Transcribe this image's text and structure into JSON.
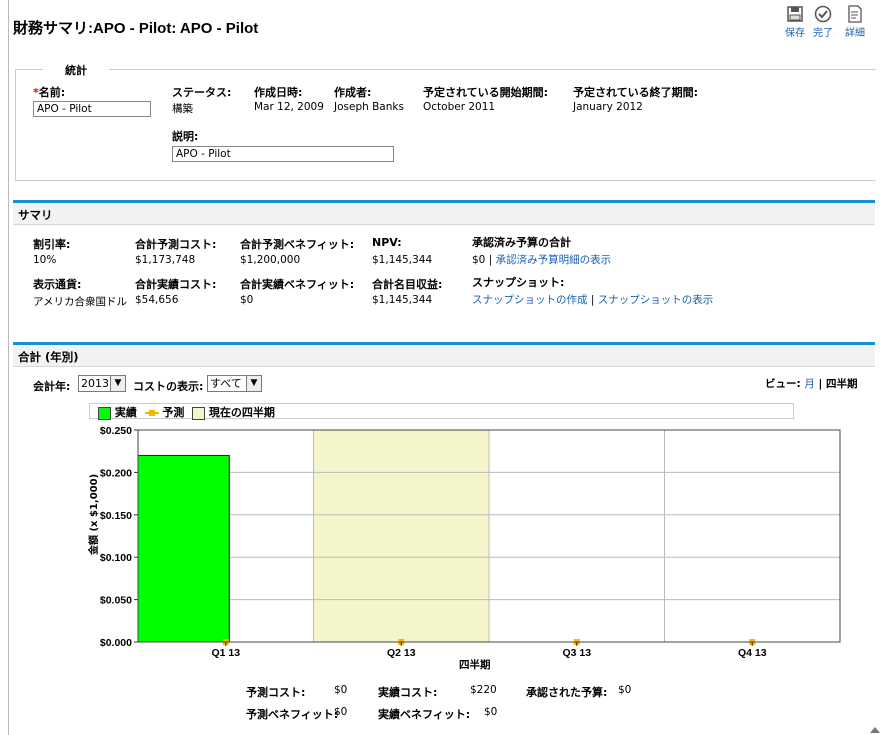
{
  "page": {
    "title": "財務サマリ:APO - Pilot: APO - Pilot"
  },
  "toolbar": {
    "save": "保存",
    "done": "完了",
    "details": "詳細"
  },
  "stats": {
    "legend": "統計",
    "name_label": "名前:",
    "name_value": "APO - Pilot",
    "status_label": "ステータス:",
    "status_value": "構築",
    "created_date_label": "作成日時:",
    "created_date_value": "Mar 12, 2009",
    "created_by_label": "作成者:",
    "created_by_value": "Joseph Banks",
    "planned_start_label": "予定されている開始期間:",
    "planned_start_value": "October 2011",
    "planned_end_label": "予定されている終了期間:",
    "planned_end_value": "January 2012",
    "description_label": "説明:",
    "description_value": "APO - Pilot"
  },
  "summary": {
    "heading": "サマリ",
    "discount_label": "割引率:",
    "discount_value": "10%",
    "forecast_cost_label": "合計予測コスト:",
    "forecast_cost_value": "$1,173,748",
    "forecast_benefit_label": "合計予測ベネフィット:",
    "forecast_benefit_value": "$1,200,000",
    "npv_label": "NPV:",
    "npv_value": "$1,145,344",
    "approved_budget_label": "承認済み予算の合計",
    "approved_budget_value": "$0 |",
    "approved_budget_link": "承認済み予算明細の表示",
    "currency_label": "表示通貨:",
    "currency_value": "アメリカ合衆国ドル",
    "actual_cost_label": "合計実績コスト:",
    "actual_cost_value": "$54,656",
    "actual_benefit_label": "合計実績ベネフィット:",
    "actual_benefit_value": "$0",
    "nominal_return_label": "合計名目収益:",
    "nominal_return_value": "$1,145,344",
    "snapshot_label": "スナップショット:",
    "snapshot_create": "スナップショットの作成",
    "snapshot_sep": " | ",
    "snapshot_view": "スナップショットの表示"
  },
  "totals": {
    "heading": "合計 (年別)",
    "fiscal_year_label": "会計年:",
    "fiscal_year_value": "2013",
    "cost_display_label": "コストの表示:",
    "cost_display_value": "すべて",
    "view_label": "ビュー:",
    "view_month": "月",
    "view_sep": " | ",
    "view_quarter": "四半期"
  },
  "legend": {
    "actual": "実績",
    "forecast": "予測",
    "current_quarter": "現在の四半期"
  },
  "colors": {
    "actual": "#00ff00",
    "forecast": "#f5b800",
    "current_quarter": "#f5f5cc",
    "accent": "#1593d0",
    "link": "#1a5fb4"
  },
  "chart_data": {
    "type": "bar",
    "categories": [
      "Q1 13",
      "Q2 13",
      "Q3 13",
      "Q4 13"
    ],
    "series": [
      {
        "name": "実績",
        "values": [
          0.22,
          0,
          0,
          0
        ]
      },
      {
        "name": "予測",
        "values": [
          0,
          0,
          0,
          0
        ]
      }
    ],
    "current_quarter_index": 1,
    "ylabel": "金額 (x $1,000)",
    "xlabel": "四半期",
    "ylim": [
      0,
      0.25
    ],
    "yticks": [
      "$0.000",
      "$0.050",
      "$0.100",
      "$0.150",
      "$0.200",
      "$0.250"
    ],
    "grid": true
  },
  "footer": {
    "forecast_cost_label": "予測コスト:",
    "forecast_cost_value": "$0",
    "actual_cost_label": "実績コスト:",
    "actual_cost_value": "$220",
    "approved_budget_label": "承認された予算:",
    "approved_budget_value": "$0",
    "forecast_benefit_label": "予測ベネフィット:",
    "forecast_benefit_value": "$0",
    "actual_benefit_label": "実績ベネフィット:",
    "actual_benefit_value": "$0"
  }
}
